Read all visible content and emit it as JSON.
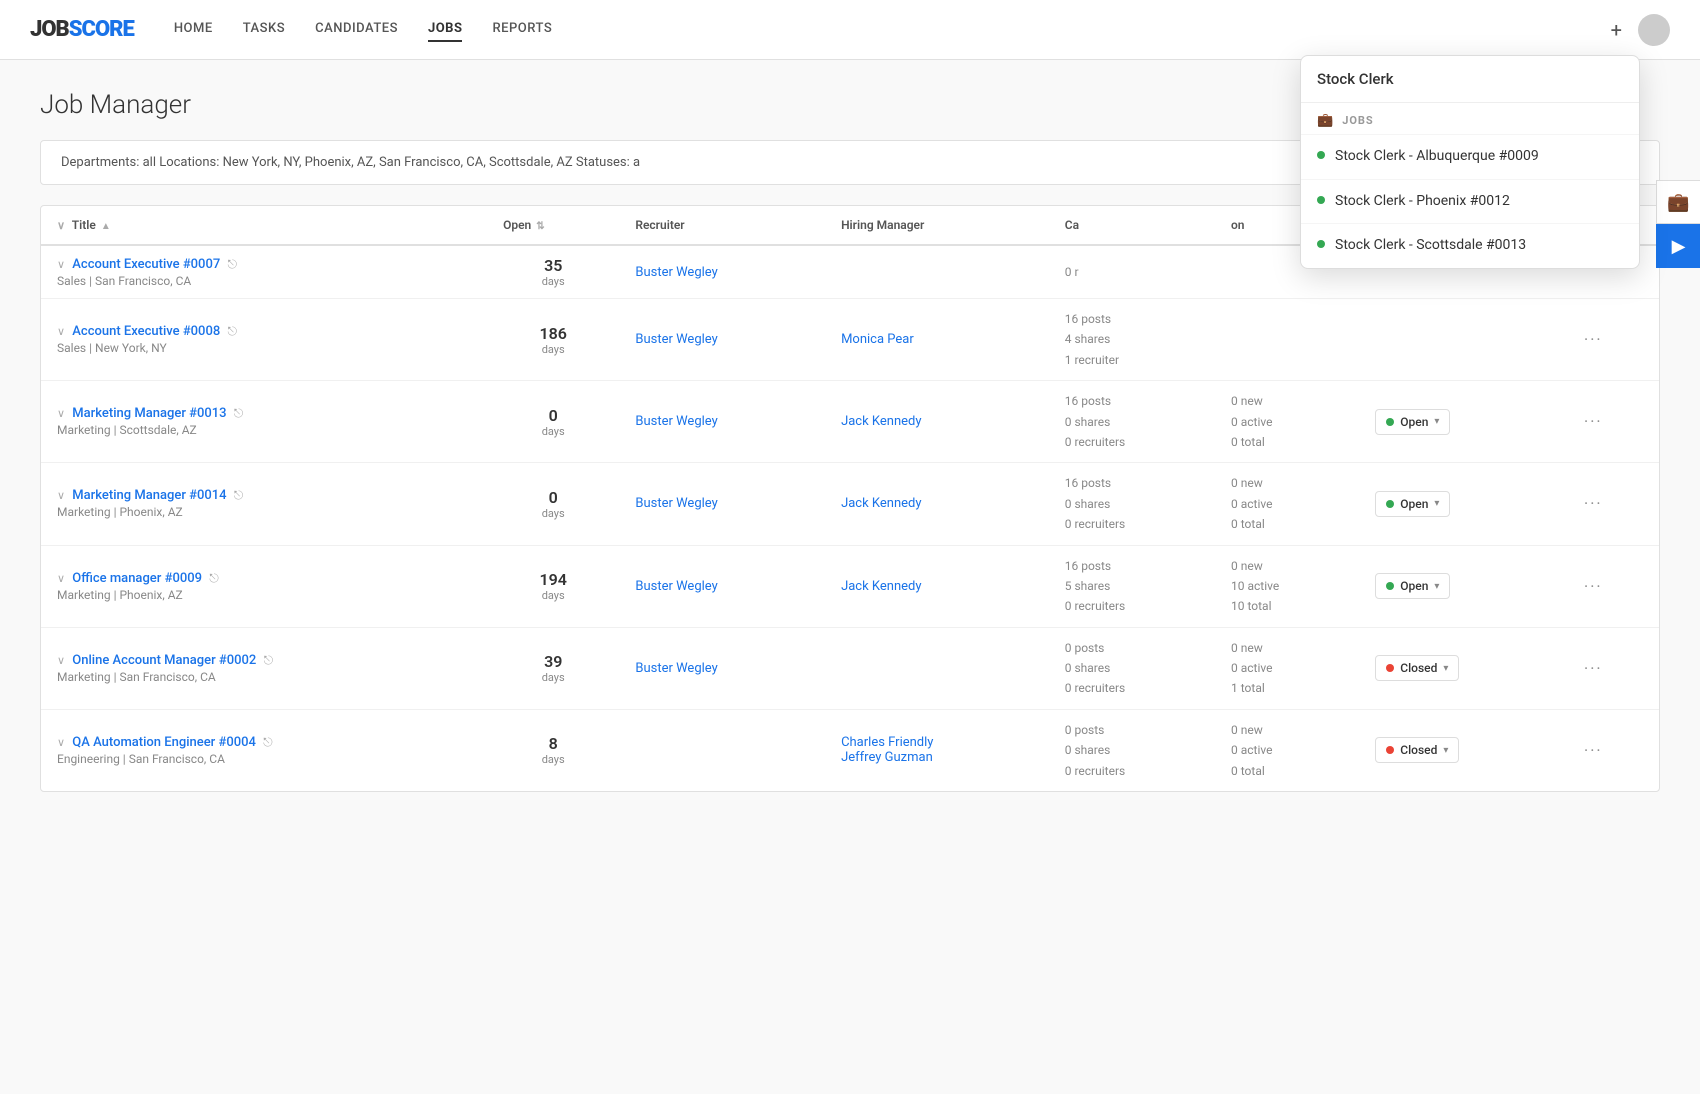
{
  "app": {
    "logo_job": "JOB",
    "logo_score": "SCORE"
  },
  "nav": {
    "links": [
      {
        "label": "HOME",
        "active": false
      },
      {
        "label": "TASKS",
        "active": false
      },
      {
        "label": "CANDIDATES",
        "active": false
      },
      {
        "label": "JOBS",
        "active": true
      },
      {
        "label": "REPORTS",
        "active": false
      }
    ],
    "plus": "+",
    "briefcase_icon": "💼"
  },
  "page": {
    "title": "Job Manager"
  },
  "filter": {
    "text": "Departments: all   Locations: New York, NY, Phoenix, AZ, San Francisco, CA, Scottsdale, AZ   Statuses: a"
  },
  "table": {
    "headers": [
      "Title",
      "Open",
      "Recruiter",
      "Hiring Manager",
      "Ca",
      "on"
    ],
    "rows": [
      {
        "title": "Account Executive #0007",
        "subtitle": "Sales | San Francisco, CA",
        "open_days": "35",
        "recruiter": "Buster Wegley",
        "hiring_manager": "",
        "posts": "0 r",
        "new": "",
        "active": "",
        "total": "",
        "status": "",
        "status_type": "hidden"
      },
      {
        "title": "Account Executive #0008",
        "subtitle": "Sales | New York, NY",
        "open_days": "186",
        "recruiter": "Buster Wegley",
        "hiring_manager": "Monica Pear",
        "posts": "16 posts",
        "posts2": "4 shares",
        "posts3": "1 recruiter",
        "new": "",
        "active": "",
        "total": "",
        "status": "",
        "status_type": "hidden"
      },
      {
        "title": "Marketing Manager #0013",
        "subtitle": "Marketing | Scottsdale, AZ",
        "open_days": "0",
        "recruiter": "Buster Wegley",
        "hiring_manager": "Jack Kennedy",
        "posts": "16 posts",
        "posts2": "0 shares",
        "posts3": "0 recruiters",
        "new": "0 new",
        "active": "0 active",
        "total": "0 total",
        "status": "Open",
        "status_type": "open"
      },
      {
        "title": "Marketing Manager #0014",
        "subtitle": "Marketing | Phoenix, AZ",
        "open_days": "0",
        "recruiter": "Buster Wegley",
        "hiring_manager": "Jack Kennedy",
        "posts": "16 posts",
        "posts2": "0 shares",
        "posts3": "0 recruiters",
        "new": "0 new",
        "active": "0 active",
        "total": "0 total",
        "status": "Open",
        "status_type": "open"
      },
      {
        "title": "Office manager #0009",
        "subtitle": "Marketing | Phoenix, AZ",
        "open_days": "194",
        "recruiter": "Buster Wegley",
        "hiring_manager": "Jack Kennedy",
        "posts": "16 posts",
        "posts2": "5 shares",
        "posts3": "0 recruiters",
        "new": "0 new",
        "active": "10 active",
        "total": "10 total",
        "status": "Open",
        "status_type": "open"
      },
      {
        "title": "Online Account Manager #0002",
        "subtitle": "Marketing | San Francisco, CA",
        "open_days": "39",
        "recruiter": "Buster Wegley",
        "hiring_manager": "",
        "posts": "0 posts",
        "posts2": "0 shares",
        "posts3": "0 recruiters",
        "new": "0 new",
        "active": "0 active",
        "total": "1 total",
        "status": "Closed",
        "status_type": "closed"
      },
      {
        "title": "QA Automation Engineer #0004",
        "subtitle": "Engineering | San Francisco, CA",
        "open_days": "8",
        "recruiter": "",
        "hiring_manager": "Charles Friendly\nJeffrey Guzman",
        "posts": "0 posts",
        "posts2": "0 shares",
        "posts3": "0 recruiters",
        "new": "0 new",
        "active": "0 active",
        "total": "0 total",
        "status": "Closed",
        "status_type": "closed"
      }
    ]
  },
  "dropdown": {
    "search_value": "Stock Clerk",
    "section_label": "JOBS",
    "items": [
      {
        "label": "Stock Clerk - Albuquerque #0009"
      },
      {
        "label": "Stock Clerk - Phoenix #0012"
      },
      {
        "label": "Stock Clerk - Scottsdale #0013"
      }
    ]
  },
  "sidebar": {
    "briefcase": "💼",
    "arrow": "▶"
  }
}
